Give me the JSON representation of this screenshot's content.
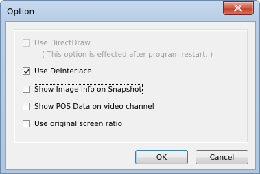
{
  "window": {
    "title": "Option",
    "close_icon": "close-icon"
  },
  "options": {
    "use_directdraw": {
      "label": "Use DirectDraw",
      "checked": false,
      "enabled": false
    },
    "note": "( This option is effected after program restart. )",
    "use_deinterlace": {
      "label": "Use DeInterlace",
      "checked": true,
      "enabled": true
    },
    "show_image_info": {
      "label": "Show Image Info on Snapshot",
      "checked": false,
      "enabled": true
    },
    "show_pos_data": {
      "label": "Show POS Data on video channel",
      "checked": false,
      "enabled": true
    },
    "use_original_ratio": {
      "label": "Use original screen ratio",
      "checked": false,
      "enabled": true
    }
  },
  "buttons": {
    "ok_label": "OK",
    "cancel_label": "Cancel"
  }
}
